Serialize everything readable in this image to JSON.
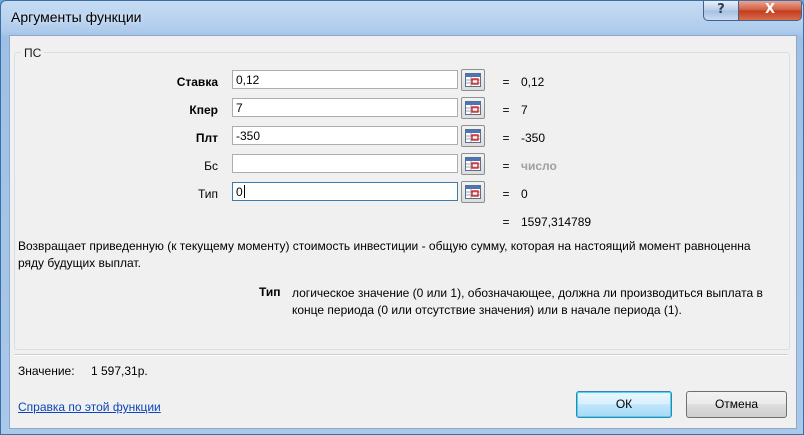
{
  "window": {
    "title": "Аргументы функции",
    "help_glyph": "?",
    "close_glyph": "X"
  },
  "group": {
    "caption": "ПС"
  },
  "args": [
    {
      "label": "Ставка",
      "value": "0,12",
      "equals": "=",
      "result": "0,12",
      "required": true
    },
    {
      "label": "Кпер",
      "value": "7",
      "equals": "=",
      "result": "7",
      "required": true
    },
    {
      "label": "Плт",
      "value": "-350",
      "equals": "=",
      "result": "-350",
      "required": true
    },
    {
      "label": "Бс",
      "value": "",
      "equals": "=",
      "result": "число",
      "required": false
    },
    {
      "label": "Тип",
      "value": "0",
      "equals": "=",
      "result": "0",
      "required": false
    }
  ],
  "formula_result": {
    "equals": "=",
    "value": "1597,314789"
  },
  "description": "Возвращает приведенную (к текущему моменту) стоимость инвестиции - общую сумму, которая на настоящий момент равноценна ряду будущих выплат.",
  "param_help": {
    "name": "Тип",
    "text": "логическое значение (0 или 1), обозначающее, должна ли производиться выплата в конце периода (0 или отсутствие значения) или в начале периода (1)."
  },
  "result": {
    "label": "Значение:",
    "value": "1 597,31р."
  },
  "help_link": "Справка по этой функции",
  "buttons": {
    "ok": "ОК",
    "cancel": "Отмена"
  },
  "colors": {
    "link": "#0d46b8",
    "hint": "#a0a0a0",
    "close_button": "#c23a1b"
  }
}
